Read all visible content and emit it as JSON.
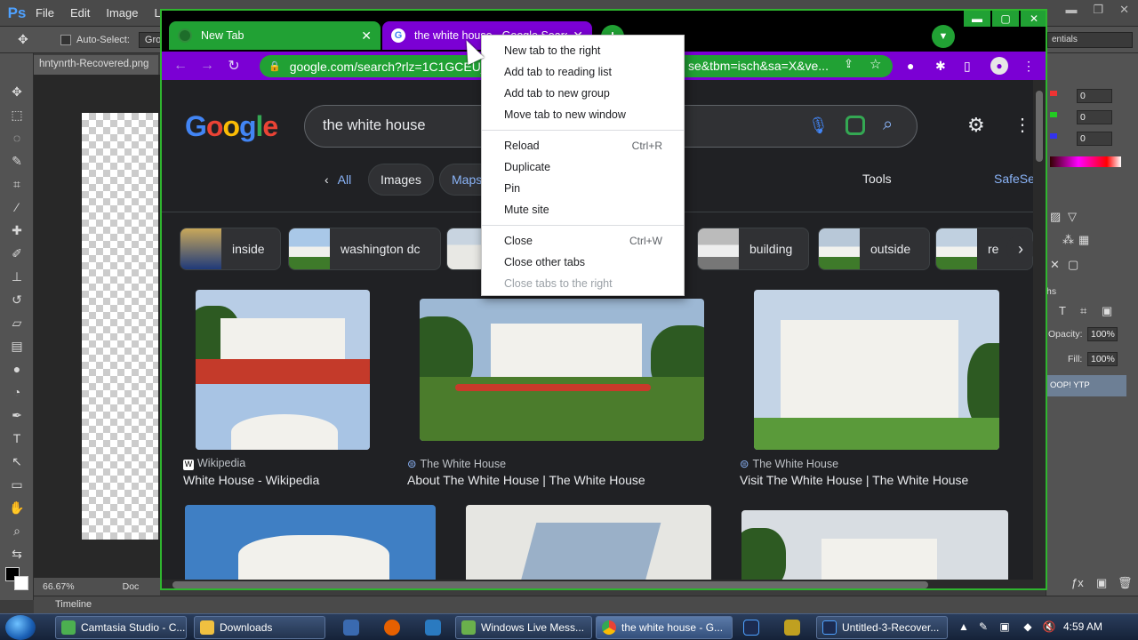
{
  "photoshop": {
    "logo": "Ps",
    "menus": [
      "File",
      "Edit",
      "Image",
      "L"
    ],
    "options": {
      "auto_select_label": "Auto-Select:",
      "auto_select_value": "Gro",
      "workspace": "entials"
    },
    "document_tab": "hntynrth-Recovered.png",
    "zoom": "66.67%",
    "doc_label": "Doc",
    "timeline_label": "Timeline",
    "color_values": [
      "0",
      "0",
      "0"
    ],
    "opacity_label": "Opacity:",
    "opacity_value": "100%",
    "fill_label": "Fill:",
    "fill_value": "100%",
    "layer_name": "OOP! YTP",
    "panel_tab": "hs"
  },
  "chrome": {
    "tabs": [
      {
        "title": "New Tab",
        "active": false
      },
      {
        "title": "the white house - Google Search",
        "active": true
      }
    ],
    "url": "google.com/search?rlz=1C1GCEU_e",
    "url_tail": "se&tbm=isch&sa=X&ve...",
    "colors": {
      "tab_green": "#21a134",
      "tab_purple": "#7b00d4",
      "frame_green": "#2fb52f"
    }
  },
  "google": {
    "logo": "Google",
    "query": "the white house",
    "filters": {
      "back": "All",
      "images": "Images",
      "maps": "Maps"
    },
    "tools": "Tools",
    "safesearch": "SafeSe",
    "chips": [
      {
        "label": "inside"
      },
      {
        "label": "washington dc"
      },
      {
        "label": "building"
      },
      {
        "label": "outside"
      },
      {
        "label": "re"
      }
    ],
    "results": [
      {
        "source": "Wikipedia",
        "title": "White House - Wikipedia"
      },
      {
        "source": "The White House",
        "title": "About The White House | The White House"
      },
      {
        "source": "The White House",
        "title": "Visit The White House | The White House"
      }
    ]
  },
  "context_menu": {
    "group1": [
      "New tab to the right",
      "Add tab to reading list",
      "Add tab to new group",
      "Move tab to new window"
    ],
    "reload": {
      "label": "Reload",
      "shortcut": "Ctrl+R"
    },
    "duplicate": "Duplicate",
    "pin": "Pin",
    "mute": "Mute site",
    "close": {
      "label": "Close",
      "shortcut": "Ctrl+W"
    },
    "close_others": "Close other tabs",
    "close_right": "Close tabs to the right"
  },
  "taskbar": {
    "tasks": [
      "Camtasia Studio - C...",
      "Downloads",
      "Windows Live Mess...",
      "the white house - G...",
      "Untitled-3-Recover..."
    ],
    "clock": "4:59 AM"
  }
}
